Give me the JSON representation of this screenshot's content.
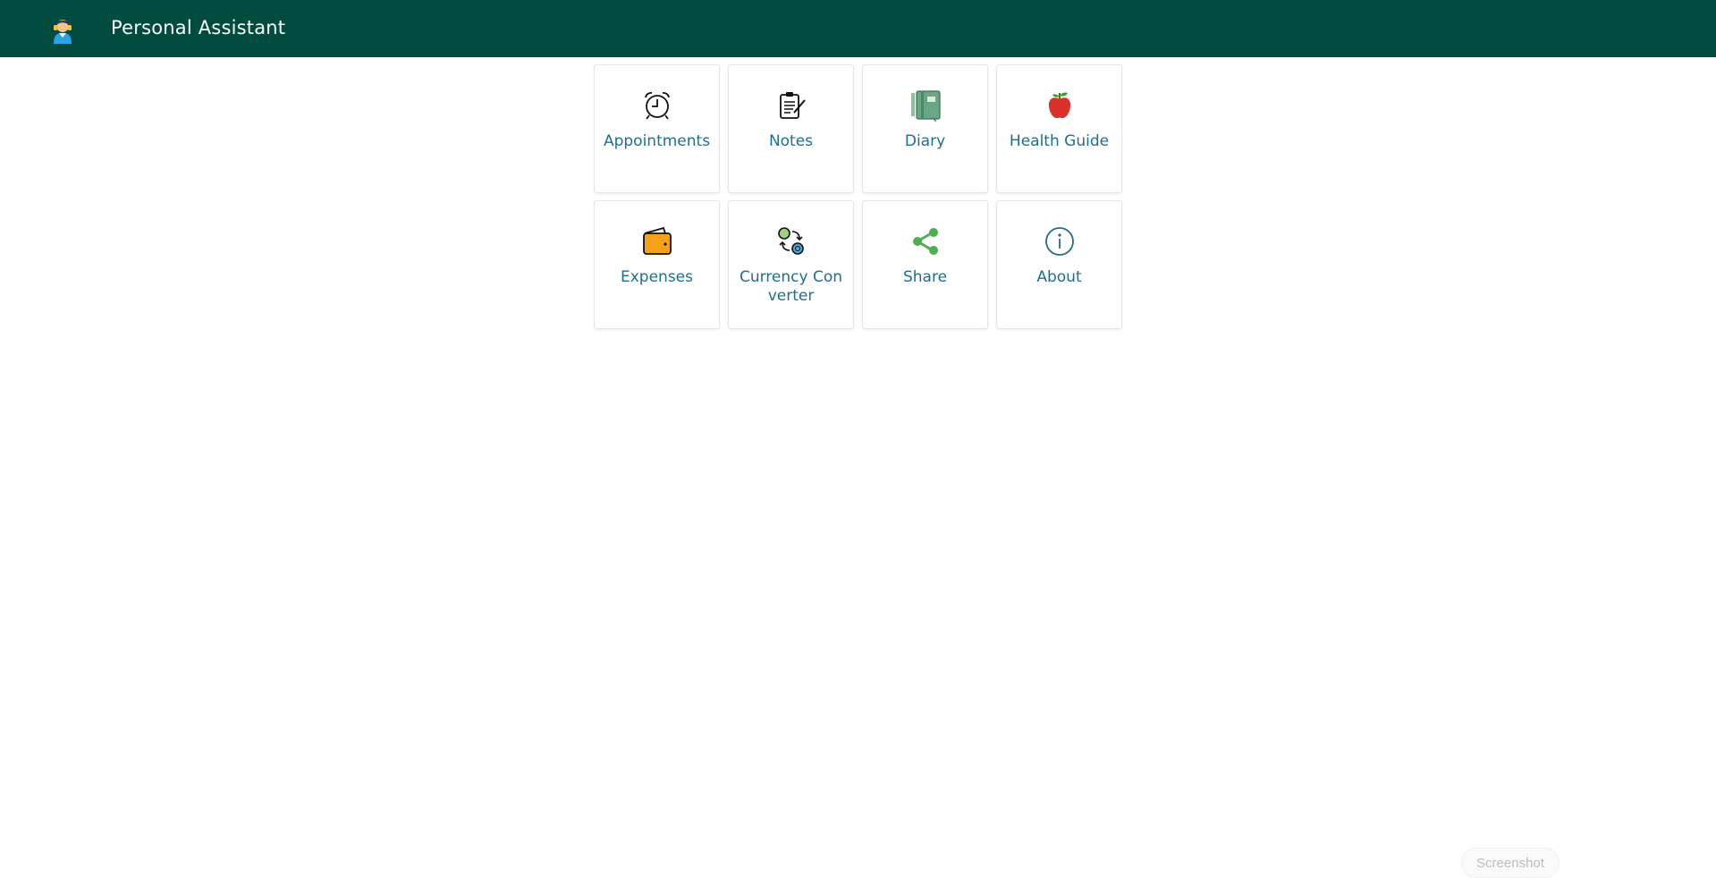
{
  "header": {
    "title": "Personal Assistant",
    "logo_icon": "assistant-headset-icon",
    "background": "#024b3f"
  },
  "tiles": [
    {
      "label": "Appointments",
      "icon": "alarm-clock-icon"
    },
    {
      "label": "Notes",
      "icon": "clipboard-pen-icon"
    },
    {
      "label": "Diary",
      "icon": "notebook-icon"
    },
    {
      "label": "Health Guide",
      "icon": "apple-icon"
    },
    {
      "label": "Expenses",
      "icon": "wallet-icon"
    },
    {
      "label": "Currency Converter",
      "icon": "currency-exchange-icon"
    },
    {
      "label": "Share",
      "icon": "share-icon"
    },
    {
      "label": "About",
      "icon": "info-icon"
    }
  ],
  "footer": {
    "screenshot_label": "Screenshot"
  },
  "colors": {
    "tile_label": "#1f6e8c",
    "share_icon": "#4caf50",
    "about_icon": "#1f6e8c"
  }
}
